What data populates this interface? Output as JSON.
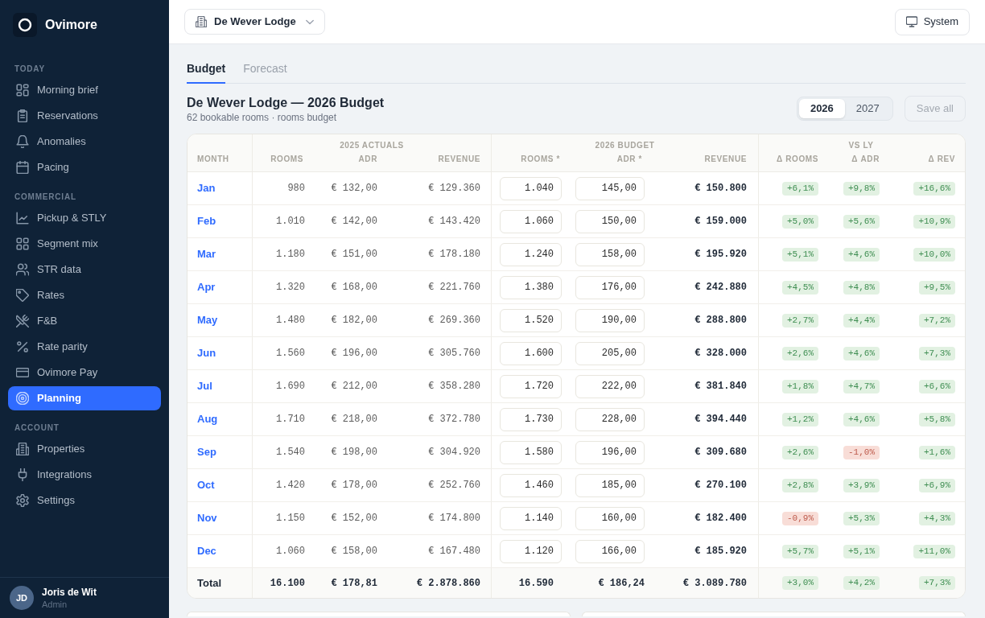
{
  "sidebar": {
    "brand": "Ovimore",
    "sections": [
      {
        "heading": "TODAY",
        "items": [
          {
            "label": "Morning brief",
            "selected": false
          },
          {
            "label": "Reservations",
            "selected": false
          },
          {
            "label": "Anomalies",
            "selected": false
          },
          {
            "label": "Pacing",
            "selected": false
          }
        ]
      },
      {
        "heading": "COMMERCIAL",
        "items": [
          {
            "label": "Pickup & STLY",
            "selected": false
          },
          {
            "label": "Segment mix",
            "selected": false
          },
          {
            "label": "STR data",
            "selected": false
          },
          {
            "label": "Rates",
            "selected": false
          },
          {
            "label": "F&B",
            "selected": false
          },
          {
            "label": "Rate parity",
            "selected": false
          },
          {
            "label": "Ovimore Pay",
            "selected": false
          },
          {
            "label": "Planning",
            "selected": true
          }
        ]
      },
      {
        "heading": "ACCOUNT",
        "items": [
          {
            "label": "Properties",
            "selected": false
          },
          {
            "label": "Integrations",
            "selected": false
          },
          {
            "label": "Settings",
            "selected": false
          }
        ]
      }
    ],
    "user": {
      "initials": "JD",
      "name": "Joris de Wit",
      "role": "Admin"
    }
  },
  "top_bar": {
    "property": "De Wever Lodge",
    "theme_button": "System"
  },
  "tabs": [
    {
      "label": "Budget",
      "selected": true
    },
    {
      "label": "Forecast",
      "selected": false
    }
  ],
  "title": "De Wever Lodge — 2026 Budget",
  "subtitle": "62 bookable rooms · rooms budget",
  "years": [
    {
      "label": "2026",
      "selected": true
    },
    {
      "label": "2027",
      "selected": false
    }
  ],
  "save_button": {
    "label": "Save all",
    "disabled": true
  },
  "table": {
    "groups": [
      "2025 ACTUALS",
      "2026 BUDGET",
      "VS LY"
    ],
    "columns": [
      "MONTH",
      "ROOMS",
      "ADR",
      "REVENUE",
      "ROOMS *",
      "ADR *",
      "REVENUE",
      "Δ ROOMS",
      "Δ ADR",
      "Δ REV"
    ],
    "rows": [
      {
        "month": "Jan",
        "rooms": "980",
        "adr": "€ 132,00",
        "revenue": "€ 129.360",
        "budget_rooms": "1.040",
        "budget_adr": "145,00",
        "budget_revenue": "€ 150.800",
        "deltas": [
          {
            "value": "+6,1%",
            "kind": "up"
          },
          {
            "value": "+9,8%",
            "kind": "up"
          },
          {
            "value": "+16,6%",
            "kind": "up"
          }
        ]
      },
      {
        "month": "Feb",
        "rooms": "1.010",
        "adr": "€ 142,00",
        "revenue": "€ 143.420",
        "budget_rooms": "1.060",
        "budget_adr": "150,00",
        "budget_revenue": "€ 159.000",
        "deltas": [
          {
            "value": "+5,0%",
            "kind": "up"
          },
          {
            "value": "+5,6%",
            "kind": "up"
          },
          {
            "value": "+10,9%",
            "kind": "up"
          }
        ]
      },
      {
        "month": "Mar",
        "rooms": "1.180",
        "adr": "€ 151,00",
        "revenue": "€ 178.180",
        "budget_rooms": "1.240",
        "budget_adr": "158,00",
        "budget_revenue": "€ 195.920",
        "deltas": [
          {
            "value": "+5,1%",
            "kind": "up"
          },
          {
            "value": "+4,6%",
            "kind": "up"
          },
          {
            "value": "+10,0%",
            "kind": "up"
          }
        ]
      },
      {
        "month": "Apr",
        "rooms": "1.320",
        "adr": "€ 168,00",
        "revenue": "€ 221.760",
        "budget_rooms": "1.380",
        "budget_adr": "176,00",
        "budget_revenue": "€ 242.880",
        "deltas": [
          {
            "value": "+4,5%",
            "kind": "up"
          },
          {
            "value": "+4,8%",
            "kind": "up"
          },
          {
            "value": "+9,5%",
            "kind": "up"
          }
        ]
      },
      {
        "month": "May",
        "rooms": "1.480",
        "adr": "€ 182,00",
        "revenue": "€ 269.360",
        "budget_rooms": "1.520",
        "budget_adr": "190,00",
        "budget_revenue": "€ 288.800",
        "deltas": [
          {
            "value": "+2,7%",
            "kind": "up"
          },
          {
            "value": "+4,4%",
            "kind": "up"
          },
          {
            "value": "+7,2%",
            "kind": "up"
          }
        ]
      },
      {
        "month": "Jun",
        "rooms": "1.560",
        "adr": "€ 196,00",
        "revenue": "€ 305.760",
        "budget_rooms": "1.600",
        "budget_adr": "205,00",
        "budget_revenue": "€ 328.000",
        "deltas": [
          {
            "value": "+2,6%",
            "kind": "up"
          },
          {
            "value": "+4,6%",
            "kind": "up"
          },
          {
            "value": "+7,3%",
            "kind": "up"
          }
        ]
      },
      {
        "month": "Jul",
        "rooms": "1.690",
        "adr": "€ 212,00",
        "revenue": "€ 358.280",
        "budget_rooms": "1.720",
        "budget_adr": "222,00",
        "budget_revenue": "€ 381.840",
        "deltas": [
          {
            "value": "+1,8%",
            "kind": "up"
          },
          {
            "value": "+4,7%",
            "kind": "up"
          },
          {
            "value": "+6,6%",
            "kind": "up"
          }
        ]
      },
      {
        "month": "Aug",
        "rooms": "1.710",
        "adr": "€ 218,00",
        "revenue": "€ 372.780",
        "budget_rooms": "1.730",
        "budget_adr": "228,00",
        "budget_revenue": "€ 394.440",
        "deltas": [
          {
            "value": "+1,2%",
            "kind": "up"
          },
          {
            "value": "+4,6%",
            "kind": "up"
          },
          {
            "value": "+5,8%",
            "kind": "up"
          }
        ]
      },
      {
        "month": "Sep",
        "rooms": "1.540",
        "adr": "€ 198,00",
        "revenue": "€ 304.920",
        "budget_rooms": "1.580",
        "budget_adr": "196,00",
        "budget_revenue": "€ 309.680",
        "deltas": [
          {
            "value": "+2,6%",
            "kind": "up"
          },
          {
            "value": "-1,0%",
            "kind": "down"
          },
          {
            "value": "+1,6%",
            "kind": "up"
          }
        ]
      },
      {
        "month": "Oct",
        "rooms": "1.420",
        "adr": "€ 178,00",
        "revenue": "€ 252.760",
        "budget_rooms": "1.460",
        "budget_adr": "185,00",
        "budget_revenue": "€ 270.100",
        "deltas": [
          {
            "value": "+2,8%",
            "kind": "up"
          },
          {
            "value": "+3,9%",
            "kind": "up"
          },
          {
            "value": "+6,9%",
            "kind": "up"
          }
        ]
      },
      {
        "month": "Nov",
        "rooms": "1.150",
        "adr": "€ 152,00",
        "revenue": "€ 174.800",
        "budget_rooms": "1.140",
        "budget_adr": "160,00",
        "budget_revenue": "€ 182.400",
        "deltas": [
          {
            "value": "-0,9%",
            "kind": "down"
          },
          {
            "value": "+5,3%",
            "kind": "up"
          },
          {
            "value": "+4,3%",
            "kind": "up"
          }
        ]
      },
      {
        "month": "Dec",
        "rooms": "1.060",
        "adr": "€ 158,00",
        "revenue": "€ 167.480",
        "budget_rooms": "1.120",
        "budget_adr": "166,00",
        "budget_revenue": "€ 185.920",
        "deltas": [
          {
            "value": "+5,7%",
            "kind": "up"
          },
          {
            "value": "+5,1%",
            "kind": "up"
          },
          {
            "value": "+11,0%",
            "kind": "up"
          }
        ]
      }
    ],
    "total": {
      "label": "Total",
      "rooms": "16.100",
      "adr": "€ 178,81",
      "revenue": "€ 2.878.860",
      "budget_rooms": "16.590",
      "budget_adr": "€ 186,24",
      "budget_revenue": "€ 3.089.780",
      "deltas": [
        {
          "value": "+3,0%",
          "kind": "up"
        },
        {
          "value": "+4,2%",
          "kind": "up"
        },
        {
          "value": "+7,3%",
          "kind": "up"
        }
      ]
    }
  }
}
